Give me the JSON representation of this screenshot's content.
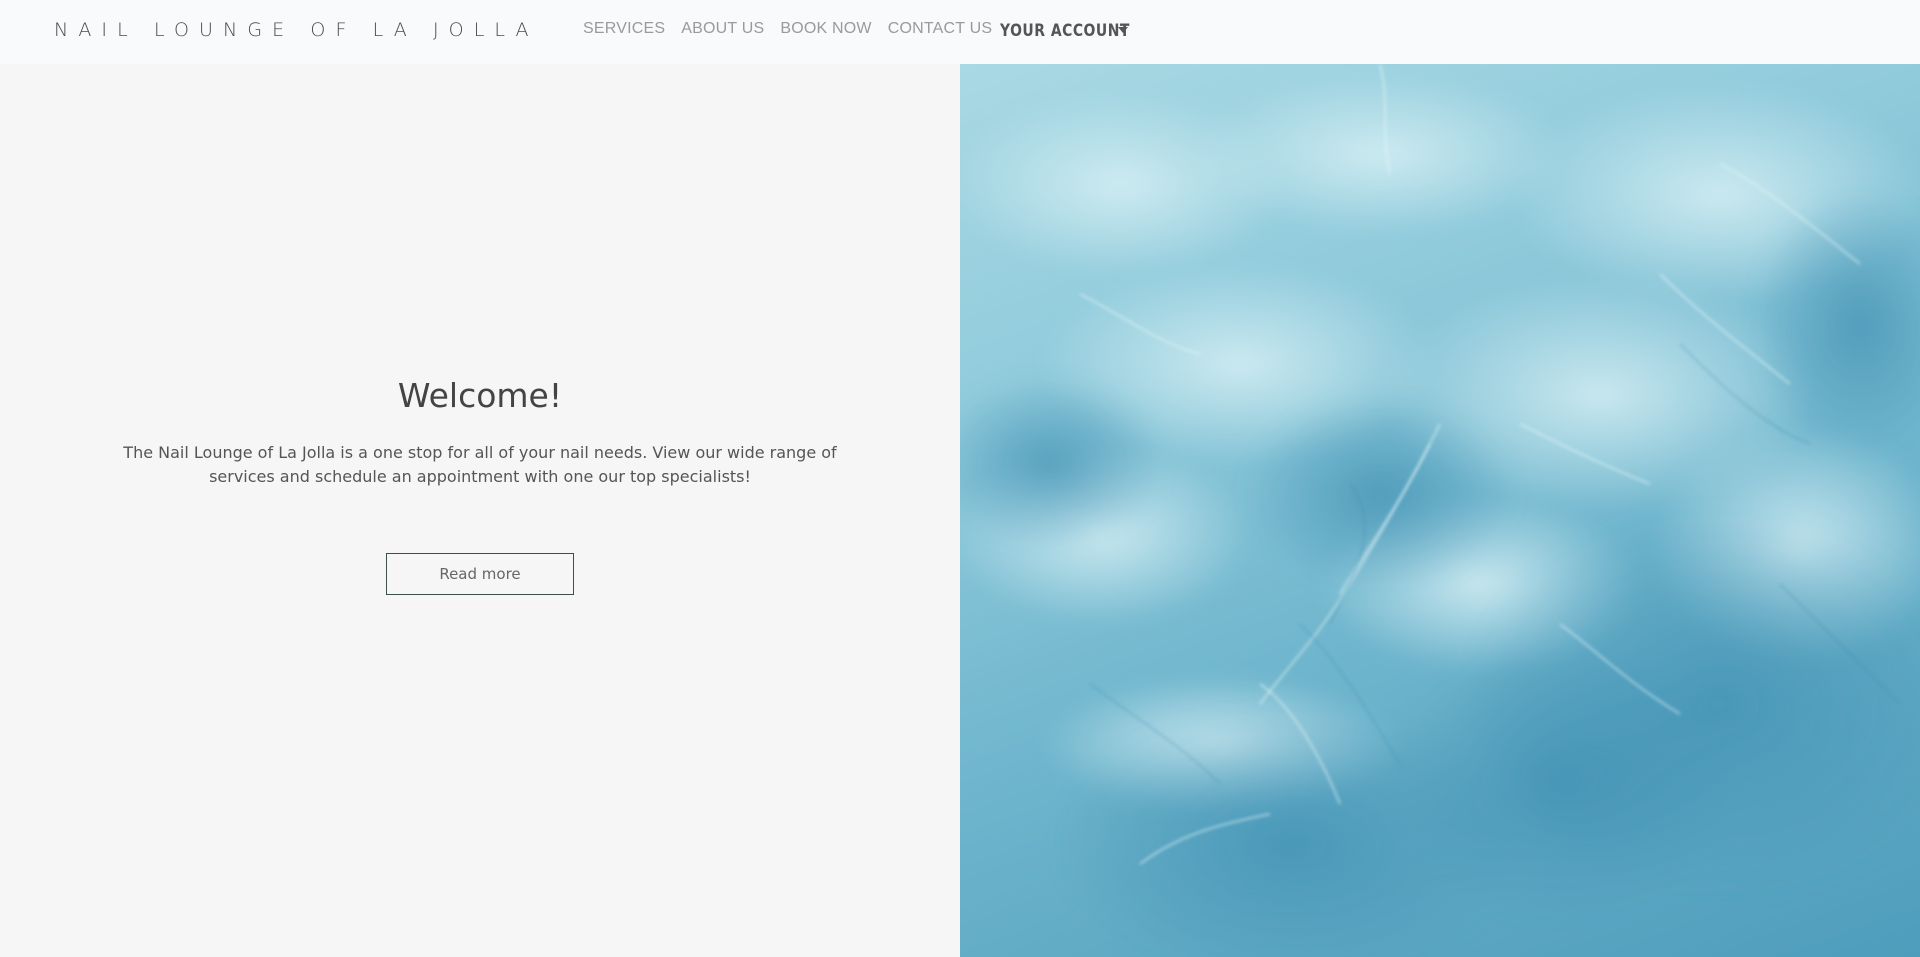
{
  "brand": {
    "name": "NAIL LOUNGE OF LA JOLLA"
  },
  "nav": {
    "items": [
      {
        "label": "SERVICES"
      },
      {
        "label": "ABOUT US"
      },
      {
        "label": "BOOK NOW"
      },
      {
        "label": "CONTACT US"
      }
    ],
    "account_label": "YOUR ACCOUNT"
  },
  "hero": {
    "title": "Welcome!",
    "body": "The Nail Lounge of La Jolla is a one stop for all of your nail needs. View our wide range of services and schedule an appointment with one our top specialists!",
    "button_label": "Read more"
  },
  "colors": {
    "page_background": "#f6f6f6",
    "header_background": "#f9fafb",
    "water_light": "#b7e2ea",
    "water_dark": "#4e9dbc",
    "button_border": "#3d4f4b"
  },
  "icons": {
    "account_caret": "caret-down-icon"
  }
}
